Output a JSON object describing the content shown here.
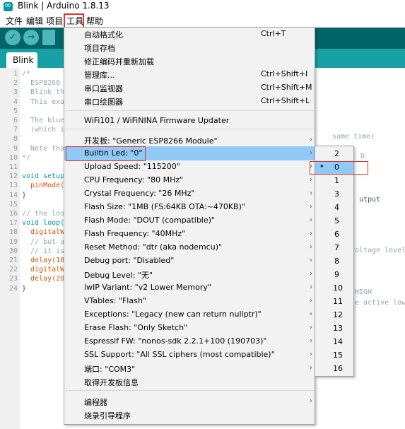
{
  "window": {
    "title": "Blink | Arduino 1.8.13"
  },
  "menubar": {
    "items": [
      "文件",
      "编辑",
      "项目",
      "工具",
      "帮助"
    ]
  },
  "tab": {
    "label": "Blink"
  },
  "editor": {
    "line_numbers": [
      "1",
      "2",
      "3",
      "4",
      "5",
      "6",
      "7",
      "8",
      "9",
      "10",
      "11",
      "12",
      "13",
      "14",
      "15",
      "16",
      "17",
      "18",
      "19",
      "20",
      "21",
      "22",
      "23",
      "24"
    ],
    "lines": [
      "/*",
      "  ESP8266",
      "  Blink th",
      "  This exa",
      "",
      "  The blue",
      "  (which i",
      "",
      "  Note tha",
      "*/",
      "",
      "void setup",
      "  pinMode(",
      "}",
      "",
      "// the loo",
      "void loop(",
      "  digitalW",
      "  // but a",
      "  // it is",
      "  delay(10",
      "  digitalW",
      "  delay(20",
      "}"
    ],
    "right_fragments": {
      "line7": "same time)",
      "line9": "D",
      "line13": "utput",
      "line18": "voltage level",
      "line22": "HIGH",
      "line23": "he active low"
    }
  },
  "tools_menu": {
    "items": [
      {
        "label": "自动格式化",
        "shortcut": "Ctrl+T"
      },
      {
        "label": "项目存档"
      },
      {
        "label": "修正编码并重新加载"
      },
      {
        "label": "管理库...",
        "shortcut": "Ctrl+Shift+I"
      },
      {
        "label": "串口监视器",
        "shortcut": "Ctrl+Shift+M"
      },
      {
        "label": "串口绘图器",
        "shortcut": "Ctrl+Shift+L"
      },
      {
        "label": "WiFi101 / WiFiNINA Firmware Updater"
      },
      {
        "label": "开发板: \"Generic ESP8266 Module\"",
        "submenu": true
      },
      {
        "label": "Builtin Led: \"0\"",
        "submenu": true,
        "highlighted": true
      },
      {
        "label": "Upload Speed: \"115200\"",
        "submenu": true
      },
      {
        "label": "CPU Frequency: \"80 MHz\"",
        "submenu": true
      },
      {
        "label": "Crystal Frequency: \"26 MHz\"",
        "submenu": true
      },
      {
        "label": "Flash Size: \"1MB (FS:64KB OTA:~470KB)\"",
        "submenu": true
      },
      {
        "label": "Flash Mode: \"DOUT (compatible)\"",
        "submenu": true
      },
      {
        "label": "Flash Frequency: \"40MHz\"",
        "submenu": true
      },
      {
        "label": "Reset Method: \"dtr (aka nodemcu)\"",
        "submenu": true
      },
      {
        "label": "Debug port: \"Disabled\"",
        "submenu": true
      },
      {
        "label": "Debug Level: \"无\"",
        "submenu": true
      },
      {
        "label": "lwIP Variant: \"v2 Lower Memory\"",
        "submenu": true
      },
      {
        "label": "VTables: \"Flash\"",
        "submenu": true
      },
      {
        "label": "Exceptions: \"Legacy (new can return nullptr)\"",
        "submenu": true
      },
      {
        "label": "Erase Flash: \"Only Sketch\"",
        "submenu": true
      },
      {
        "label": "Espressif FW: \"nonos-sdk 2.2.1+100 (190703)\"",
        "submenu": true
      },
      {
        "label": "SSL Support: \"All SSL ciphers (most compatible)\"",
        "submenu": true
      },
      {
        "label": "端口: \"COM3\"",
        "submenu": true
      },
      {
        "label": "取得开发板信息"
      },
      {
        "label": "编程器",
        "submenu": true
      },
      {
        "label": "烧录引导程序"
      }
    ]
  },
  "builtin_led_submenu": {
    "options": [
      "2",
      "0",
      "1",
      "3",
      "4",
      "5",
      "6",
      "7",
      "8",
      "9",
      "10",
      "11",
      "12",
      "13",
      "14",
      "15",
      "16"
    ],
    "selected": "0"
  },
  "colors": {
    "toolbar": "#006468",
    "tabstrip": "#17a1a5",
    "highlight": "#91c9f7",
    "annotation": "#e0312a"
  }
}
